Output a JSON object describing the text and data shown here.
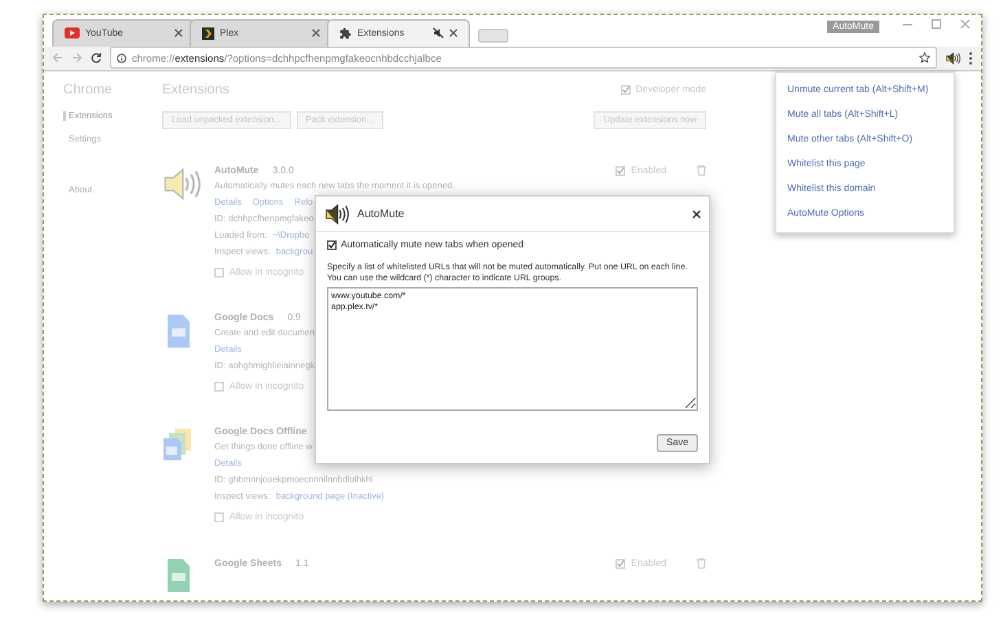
{
  "browser": {
    "tabs": [
      {
        "title": "YouTube",
        "selected": false,
        "muted": false
      },
      {
        "title": "Plex",
        "selected": false,
        "muted": false
      },
      {
        "title": "Extensions",
        "selected": true,
        "muted": true
      }
    ],
    "tooltip": "AutoMute",
    "address_host": "chrome://",
    "address_strong": "extensions",
    "address_rest": "/?options=dchhpcfhenpmgfakeocnhbdcchjalbce"
  },
  "sidebar": {
    "title": "Chrome",
    "items": [
      {
        "label": "Extensions",
        "selected": true
      },
      {
        "label": "Settings",
        "selected": false
      },
      {
        "label": "About",
        "selected": false
      }
    ]
  },
  "page": {
    "title": "Extensions",
    "developer_mode": {
      "label": "Developer mode",
      "checked": true
    },
    "buttons": [
      "Load unpacked extension...",
      "Pack extension..."
    ],
    "update_button": "Update extensions now"
  },
  "extensions": [
    {
      "name": "AutoMute",
      "version": "3.0.0",
      "description": "Automatically mutes each new tabs the moment it is opened.",
      "enabled": {
        "label": "Enabled",
        "checked": true
      },
      "lines": [
        {
          "kind": "links",
          "links": [
            "Details",
            "Options",
            "Relo"
          ]
        },
        {
          "kind": "text",
          "text": "ID: dchhpcfhenpmgfakeo"
        },
        {
          "kind": "labeled",
          "label": "Loaded from:",
          "link": "~\\Dropbo"
        },
        {
          "kind": "labeled",
          "label": "Inspect views:",
          "link": "backgrou"
        },
        {
          "kind": "incognito",
          "label": "Allow in incognito",
          "checked": false
        }
      ]
    },
    {
      "name": "Google Docs",
      "version": "0.9",
      "description": "Create and edit documen",
      "lines": [
        {
          "kind": "links",
          "links": [
            "Details"
          ]
        },
        {
          "kind": "text",
          "text": "ID: aohghmighlieiainnegk"
        },
        {
          "kind": "incognito",
          "label": "Allow in incognito",
          "checked": false
        }
      ]
    },
    {
      "name": "Google Docs Offline",
      "description": "Get things done offline w",
      "lines": [
        {
          "kind": "links",
          "links": [
            "Details"
          ]
        },
        {
          "kind": "text",
          "text": "ID: ghbmnnjooekpmoecnnnilnnbdlolhkhi"
        },
        {
          "kind": "labeled",
          "label": "Inspect views:",
          "link": "background page (Inactive)"
        },
        {
          "kind": "incognito",
          "label": "Allow in incognito",
          "checked": false
        }
      ]
    },
    {
      "name": "Google Sheets",
      "version": "1.1",
      "enabled": {
        "label": "Enabled",
        "checked": true
      }
    }
  ],
  "menu": {
    "items": [
      "Unmute current tab (Alt+Shift+M)",
      "Mute all tabs (Alt+Shift+L)",
      "Mute other tabs (Alt+Shift+O)",
      "Whitelist this page",
      "Whitelist this domain",
      "AutoMute Options"
    ]
  },
  "dialog": {
    "title": "AutoMute",
    "auto_mute": {
      "label": "Automatically mute new tabs when opened",
      "checked": true
    },
    "instructions": "Specify a list of whitelisted URLs that will not be muted automatically. Put one URL on each line. You can use the wildcard (*) character to indicate URL groups.",
    "whitelist": "www.youtube.com/*\napp.plex.tv/*",
    "save": "Save"
  }
}
